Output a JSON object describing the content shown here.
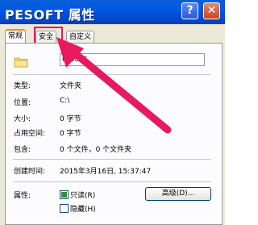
{
  "window": {
    "title": "PESOFT 属性",
    "help_label": "?",
    "close_label": "✕"
  },
  "tabs": [
    {
      "label": "常规",
      "active": true
    },
    {
      "label": "安全",
      "active": false
    },
    {
      "label": "自定义",
      "active": false
    }
  ],
  "general": {
    "name_value": "PESOFT",
    "rows": [
      {
        "label": "类型:",
        "value": "文件夹"
      },
      {
        "label": "位置:",
        "value": "C:\\"
      },
      {
        "label": "大小:",
        "value": "0 字节"
      },
      {
        "label": "占用空间:",
        "value": "0 字节"
      },
      {
        "label": "包含:",
        "value": "0 个文件，0 个文件夹"
      },
      {
        "label": "创建时间:",
        "value": "2015年3月16日, 15:37:47"
      }
    ],
    "attributes_label": "属性:",
    "readonly_label": "只读(R)",
    "hidden_label": "隐藏(H)",
    "readonly_checked": true,
    "hidden_checked": false,
    "advanced_label": "高级(D)..."
  },
  "colors": {
    "highlight": "#e8195c",
    "titlebar": "#0058e6",
    "panel": "#fcfcfe"
  },
  "icons": {
    "folder": "folder-icon",
    "arrow": "annotation-arrow"
  }
}
